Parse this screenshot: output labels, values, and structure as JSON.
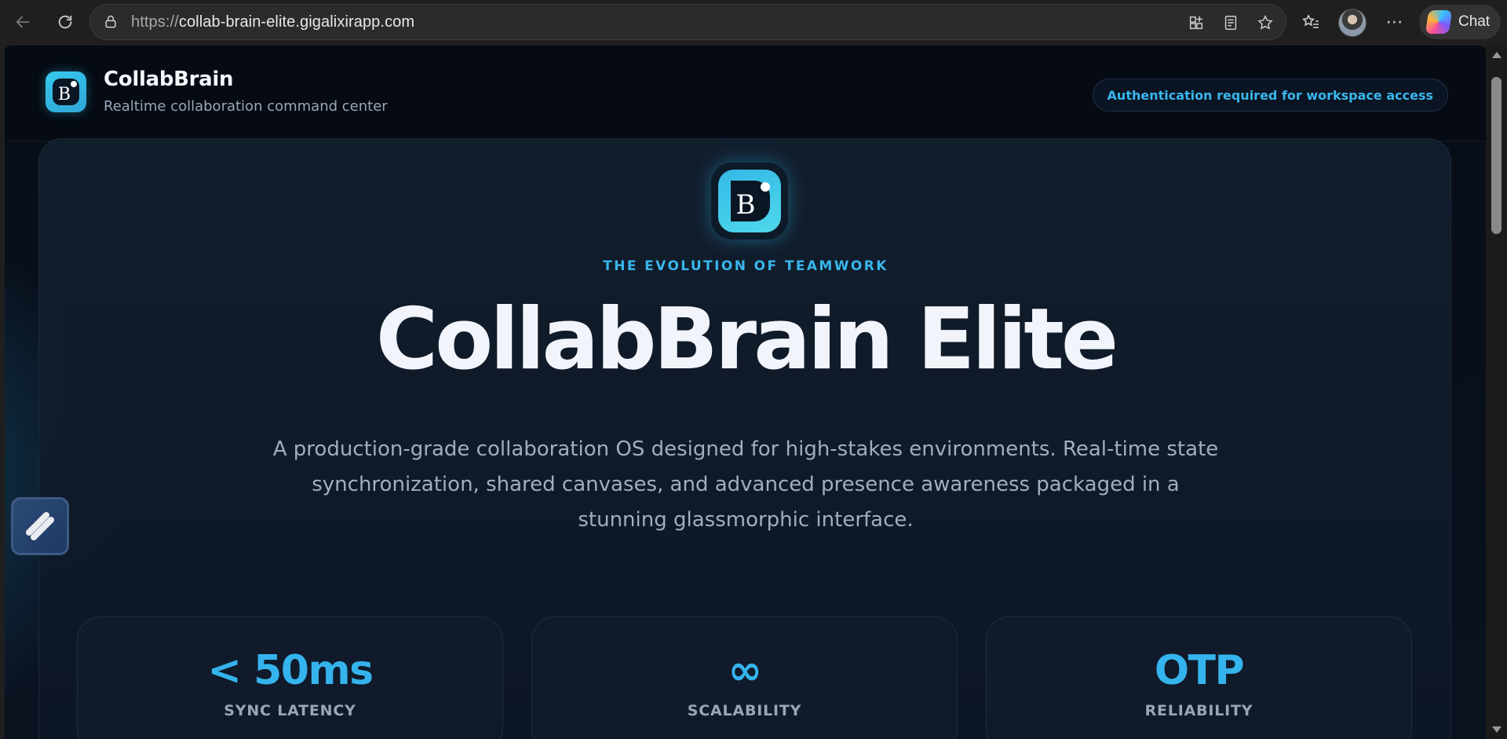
{
  "browser": {
    "url_scheme": "https://",
    "url_host": "collab-brain-elite.gigalixirapp.com",
    "chat_label": "Chat"
  },
  "header": {
    "brand_name": "CollabBrain",
    "tagline": "Realtime collaboration command center",
    "auth_notice": "Authentication required for workspace access"
  },
  "hero": {
    "eyebrow": "THE EVOLUTION OF TEAMWORK",
    "title": "CollabBrain Elite",
    "description": "A production-grade collaboration OS designed for high-stakes environments. Real-time state synchronization, shared canvases, and advanced presence awareness packaged in a stunning glassmorphic interface."
  },
  "stats": [
    {
      "value": "< 50ms",
      "label": "SYNC LATENCY"
    },
    {
      "value": "∞",
      "label": "SCALABILITY"
    },
    {
      "value": "OTP",
      "label": "RELIABILITY"
    }
  ],
  "colors": {
    "accent": "#39b6ec",
    "background": "#070d17",
    "card_border": "#1f2d40"
  }
}
